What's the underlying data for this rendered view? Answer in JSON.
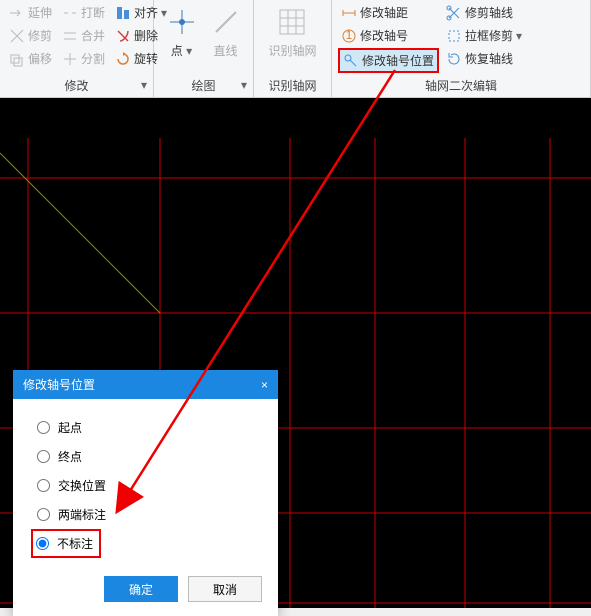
{
  "ribbon": {
    "group1": {
      "title": "修改",
      "items": [
        "延伸",
        "打断",
        "对齐",
        "修剪",
        "合并",
        "删除",
        "偏移",
        "分割",
        "旋转"
      ]
    },
    "group2": {
      "title": "绘图",
      "items": [
        "点",
        "直线"
      ]
    },
    "group3": {
      "title": "识别轴网",
      "items": [
        "识别轴网"
      ]
    },
    "group4": {
      "title": "轴网二次编辑",
      "items": [
        "修改轴距",
        "修剪轴线",
        "修改轴号",
        "拉框修剪",
        "修改轴号位置",
        "恢复轴线"
      ]
    }
  },
  "dialog": {
    "title": "修改轴号位置",
    "close": "×",
    "options": [
      "起点",
      "终点",
      "交换位置",
      "两端标注",
      "不标注"
    ],
    "ok": "确定",
    "cancel": "取消"
  }
}
